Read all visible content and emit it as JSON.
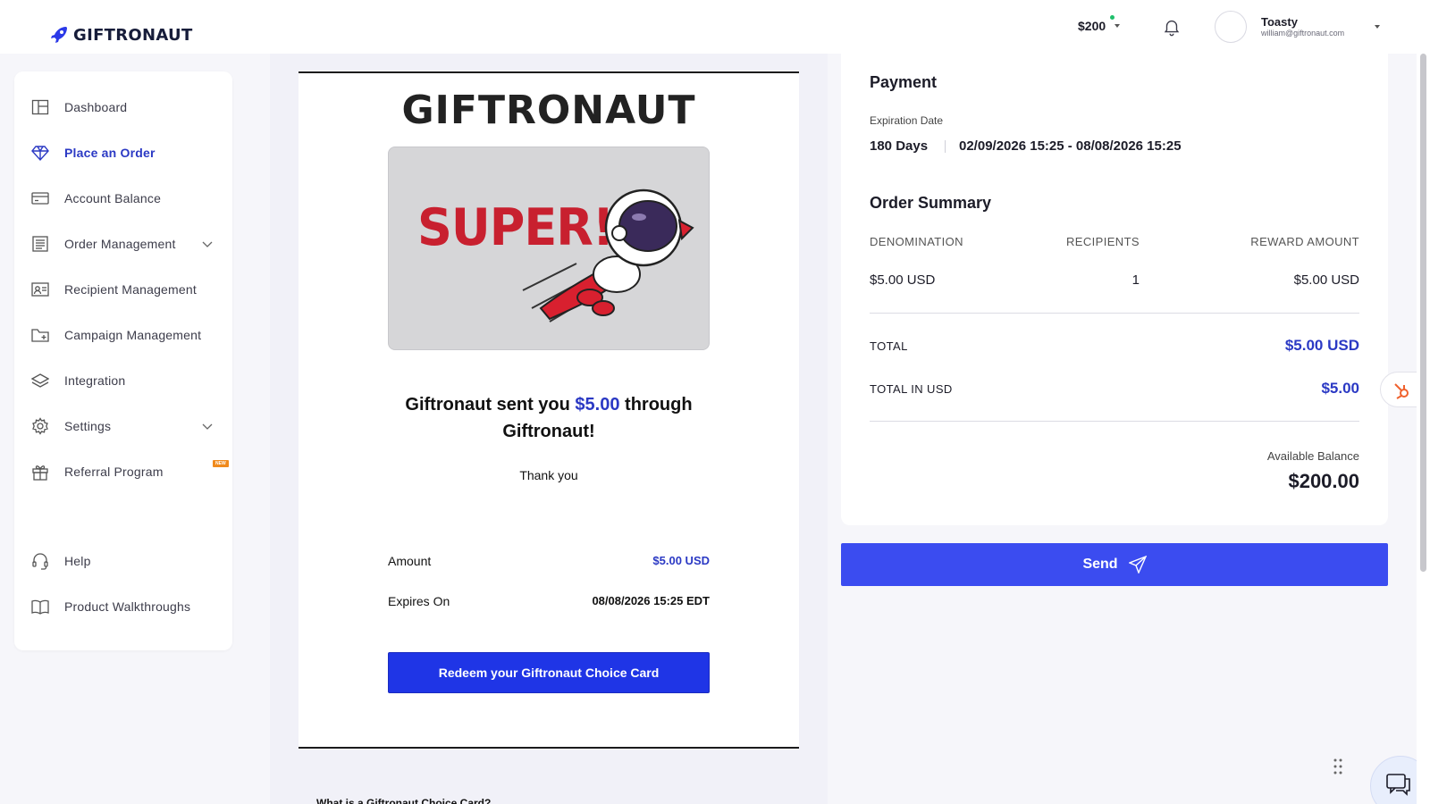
{
  "brand": {
    "name": "GIFTRONAUT"
  },
  "header": {
    "balance": "$200",
    "user_name": "Toasty",
    "user_email": "william@giftronaut.com"
  },
  "sidebar": {
    "items": [
      {
        "label": "Dashboard"
      },
      {
        "label": "Place an Order"
      },
      {
        "label": "Account Balance"
      },
      {
        "label": "Order Management"
      },
      {
        "label": "Recipient Management"
      },
      {
        "label": "Campaign Management"
      },
      {
        "label": "Integration"
      },
      {
        "label": "Settings"
      },
      {
        "label": "Referral Program"
      },
      {
        "label": "Help"
      },
      {
        "label": "Product Walkthroughs"
      }
    ],
    "new_badge": "NEW"
  },
  "preview": {
    "brand_title": "GIFTRONAUT",
    "hero_text": "SUPER!",
    "message_prefix": "Giftronaut sent you",
    "message_amount": "$5.00",
    "message_suffix": "through Giftronaut!",
    "thanks": "Thank you",
    "amount_label": "Amount",
    "amount_value": "$5.00 USD",
    "expires_label": "Expires On",
    "expires_value": "08/08/2026 15:25 EDT",
    "redeem_button": "Redeem your Giftronaut Choice Card",
    "faq_heading": "What is a Giftronaut Choice Card?"
  },
  "payment": {
    "title": "Payment",
    "expiration_label": "Expiration Date",
    "expiration_days": "180 Days",
    "expiration_range": "02/09/2026 15:25 - 08/08/2026 15:25"
  },
  "order_summary": {
    "title": "Order Summary",
    "columns": [
      "DENOMINATION",
      "RECIPIENTS",
      "REWARD AMOUNT"
    ],
    "row": {
      "denomination": "$5.00 USD",
      "recipients": "1",
      "reward_amount": "$5.00 USD"
    },
    "total_label": "TOTAL",
    "total_value": "$5.00 USD",
    "total_usd_label": "TOTAL IN USD",
    "total_usd_value": "$5.00",
    "available_label": "Available Balance",
    "available_value": "$200.00"
  },
  "actions": {
    "send": "Send"
  },
  "colors": {
    "accent": "#2b39c4",
    "send_button": "#3b4cf0",
    "redeem_button": "#1f35e6",
    "hero_red": "#c8202f"
  }
}
